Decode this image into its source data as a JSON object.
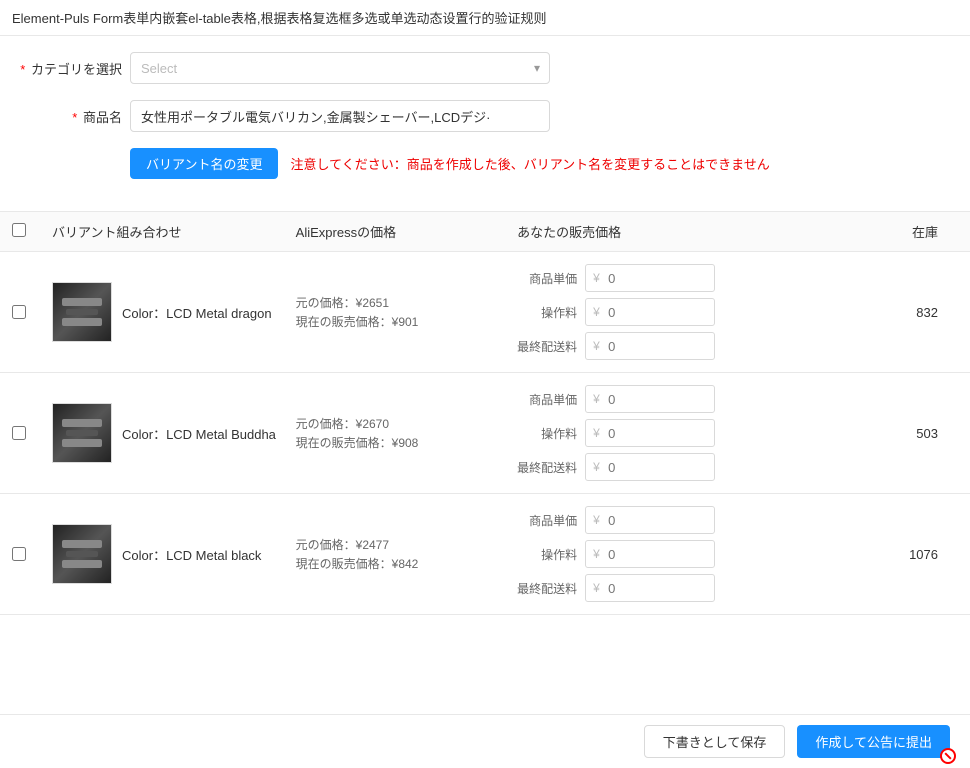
{
  "page": {
    "title": "Element-Puls Form表単内嵌套el-table表格,根据表格复选框多选或单选动态设置行的验证规则"
  },
  "form": {
    "category_label": "カテゴリを選択",
    "category_required": "*",
    "category_placeholder": "Select",
    "product_name_label": "商品名",
    "product_name_required": "*",
    "product_name_value": "女性用ポータブル電気バリカン,金属製シェーバー,LCDデジ·",
    "variant_button_label": "バリアント名の変更",
    "warning_text": "注意してください：商品を作成した後、バリアント名を変更することはできません"
  },
  "table": {
    "headers": {
      "variant": "バリアント組み合わせ",
      "aliexpress_price": "AliExpressの価格",
      "selling_price": "あなたの販売価格",
      "stock": "在庫"
    },
    "selling_labels": {
      "unit": "商品単価",
      "handling": "操作料",
      "shipping": "最終配送料"
    },
    "price_placeholder": "0",
    "rows": [
      {
        "id": 1,
        "color": "Color：LCD Metal dragon",
        "original_price_label": "元の価格：¥2651",
        "current_price_label": "現在の販売価格：¥901",
        "stock": "832"
      },
      {
        "id": 2,
        "color": "Color：LCD Metal Buddha",
        "original_price_label": "元の価格：¥2670",
        "current_price_label": "現在の販売価格：¥908",
        "stock": "503"
      },
      {
        "id": 3,
        "color": "Color：LCD Metal black",
        "original_price_label": "元の価格：¥2477",
        "current_price_label": "現在の販売価格：¥842",
        "stock": "1076"
      }
    ]
  },
  "footer": {
    "save_draft_label": "下書きとして保存",
    "submit_label": "作成して公告に提出"
  }
}
